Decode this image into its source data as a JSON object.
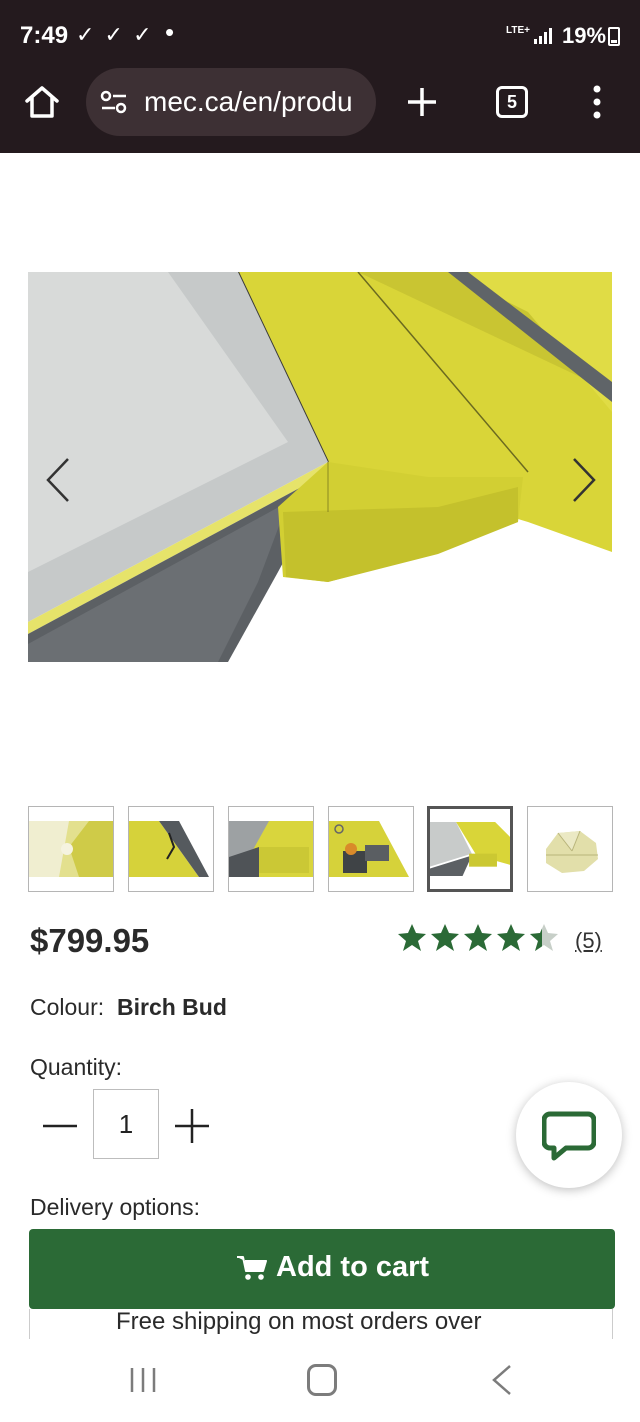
{
  "status_bar": {
    "time": "7:49",
    "notification_checks": "✓ ✓ ✓",
    "dot": "•",
    "network": "LTE+",
    "battery": "19%"
  },
  "browser": {
    "url": "mec.ca/en/produ",
    "tab_count": "5",
    "icons": [
      "home-icon",
      "site-settings-icon",
      "new-tab-icon",
      "tabs-icon",
      "menu-icon"
    ]
  },
  "product": {
    "price": "$799.95",
    "rating": 4.5,
    "rating_count": "(5)",
    "colour_label": "Colour:",
    "colour_value": "Birch Bud",
    "quantity_label": "Quantity:",
    "quantity_value": "1",
    "delivery_label": "Delivery options:",
    "add_to_cart": "Add to cart",
    "shipping_note": "Free shipping on most orders over"
  },
  "gallery": {
    "thumbnail_count": 6,
    "selected_index": 4
  },
  "colors": {
    "chrome_bg": "#241a1e",
    "url_bg": "#3d3034",
    "brand_green": "#2b6a36",
    "star_green": "#2b6a36",
    "tent_yellow": "#d6d23c"
  }
}
